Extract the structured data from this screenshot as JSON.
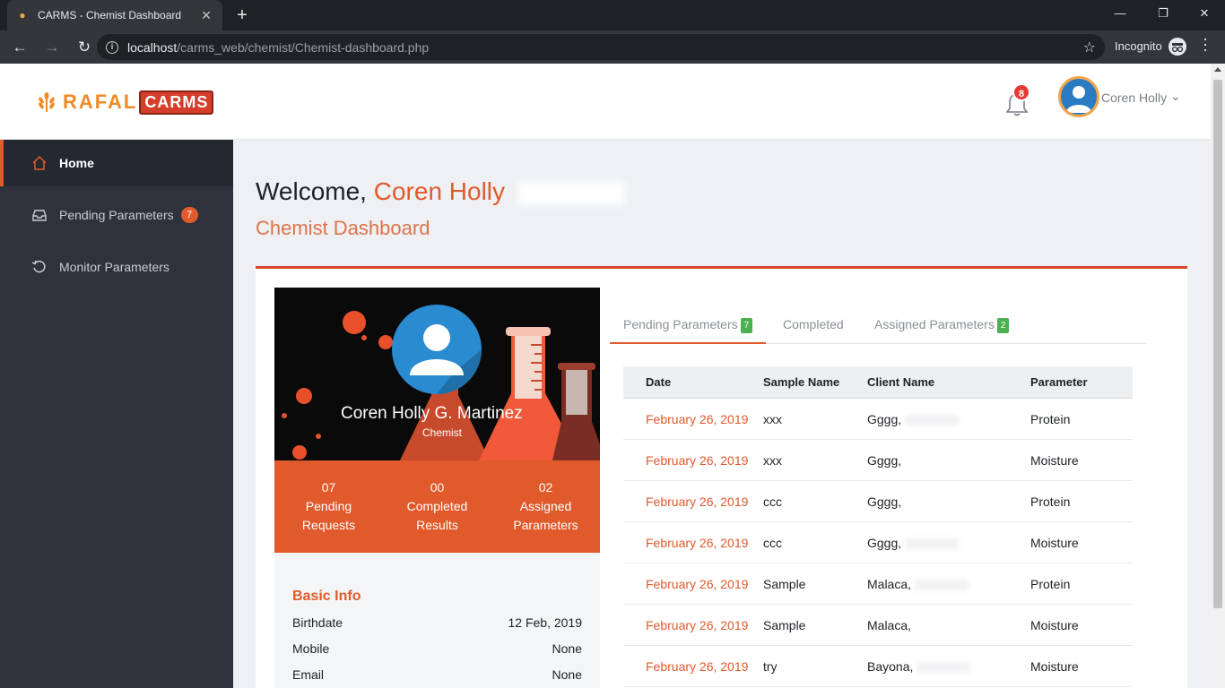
{
  "browser": {
    "tab_title": "CARMS - Chemist Dashboard",
    "url_host": "localhost",
    "url_path": "/carms_web/chemist/Chemist-dashboard.php",
    "incognito_label": "Incognito"
  },
  "header": {
    "logo_primary": "RAFAL",
    "logo_secondary": "CARMS",
    "notification_count": "8",
    "user_name": "Coren Holly"
  },
  "sidebar": {
    "items": [
      {
        "label": "Home",
        "icon": "home-icon",
        "active": true
      },
      {
        "label": "Pending Parameters",
        "icon": "inbox-icon",
        "badge": "7"
      },
      {
        "label": "Monitor Parameters",
        "icon": "history-icon"
      }
    ]
  },
  "main": {
    "welcome_prefix": "Welcome,",
    "welcome_name": "Coren Holly",
    "subtitle": "Chemist Dashboard"
  },
  "profile": {
    "full_name": "Coren Holly G. Martinez",
    "role": "Chemist",
    "stats": [
      {
        "value": "07",
        "line1": "Pending",
        "line2": "Requests"
      },
      {
        "value": "00",
        "line1": "Completed",
        "line2": "Results"
      },
      {
        "value": "02",
        "line1": "Assigned",
        "line2": "Parameters"
      }
    ],
    "basic_info_title": "Basic Info",
    "basic_info": [
      {
        "label": "Birthdate",
        "value": "12 Feb, 2019"
      },
      {
        "label": "Mobile",
        "value": "None"
      },
      {
        "label": "Email",
        "value": "None"
      }
    ]
  },
  "tabs": [
    {
      "label": "Pending Parameters",
      "badge": "7",
      "active": true
    },
    {
      "label": "Completed"
    },
    {
      "label": "Assigned Parameters",
      "badge": "2"
    }
  ],
  "table": {
    "columns": [
      "Date",
      "Sample Name",
      "Client Name",
      "Parameter"
    ],
    "rows": [
      [
        "February 26, 2019",
        "xxx",
        "Gggg,",
        "Protein"
      ],
      [
        "February 26, 2019",
        "xxx",
        "Gggg,",
        "Moisture"
      ],
      [
        "February 26, 2019",
        "ccc",
        "Gggg,",
        "Protein"
      ],
      [
        "February 26, 2019",
        "ccc",
        "Gggg,",
        "Moisture"
      ],
      [
        "February 26, 2019",
        "Sample",
        "Malaca,",
        "Protein"
      ],
      [
        "February 26, 2019",
        "Sample",
        "Malaca,",
        "Moisture"
      ],
      [
        "February 26, 2019",
        "try",
        "Bayona,",
        "Moisture"
      ]
    ]
  },
  "colors": {
    "accent": "#e05a2b",
    "sidebar_bg": "#2e323c",
    "badge_green": "#4caf50"
  }
}
